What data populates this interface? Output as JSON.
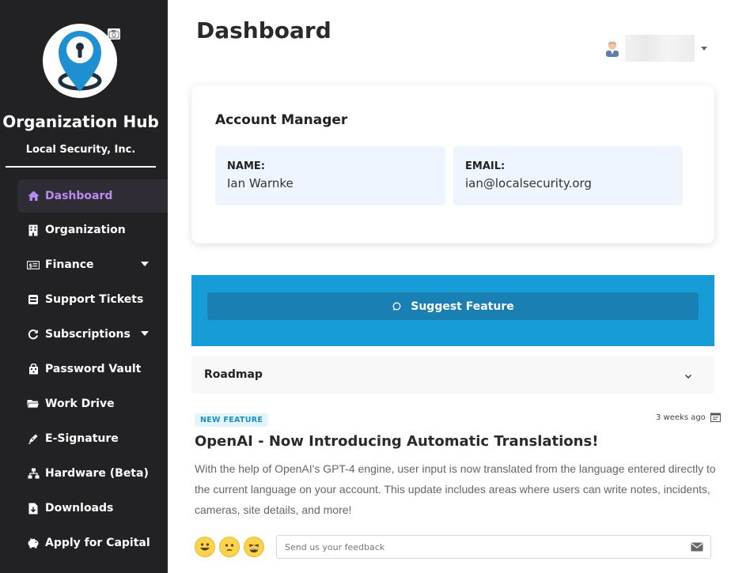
{
  "sidebar": {
    "org_title": "Organization Hub",
    "org_subtitle": "Local Security, Inc.",
    "items": [
      {
        "label": "Dashboard",
        "icon": "home-icon",
        "active": true
      },
      {
        "label": "Organization",
        "icon": "building-icon"
      },
      {
        "label": "Finance",
        "icon": "money-icon",
        "has_submenu": true
      },
      {
        "label": "Support Tickets",
        "icon": "ticket-icon"
      },
      {
        "label": "Subscriptions",
        "icon": "refresh-icon",
        "has_submenu": true
      },
      {
        "label": "Password Vault",
        "icon": "vault-icon"
      },
      {
        "label": "Work Drive",
        "icon": "folder-icon"
      },
      {
        "label": "E-Signature",
        "icon": "pen-icon"
      },
      {
        "label": "Hardware (Beta)",
        "icon": "network-icon"
      },
      {
        "label": "Downloads",
        "icon": "download-file-icon"
      },
      {
        "label": "Apply for Capital",
        "icon": "piggy-bank-icon"
      }
    ]
  },
  "header": {
    "title": "Dashboard"
  },
  "account_manager": {
    "title": "Account Manager",
    "name_label": "NAME:",
    "name_value": "Ian Warnke",
    "email_label": "EMAIL:",
    "email_value": "ian@localsecurity.org"
  },
  "suggest": {
    "button_label": "Suggest Feature"
  },
  "roadmap": {
    "label": "Roadmap"
  },
  "news": {
    "badge": "NEW FEATURE",
    "timestamp": "3 weeks ago",
    "title": "OpenAI - Now Introducing Automatic Translations!",
    "body": "With the help of OpenAI's GPT-4 engine, user input is now translated from the language entered directly to the current language on your account. This update includes areas where users can write notes, incidents, cameras, site details, and more!"
  },
  "feedback": {
    "placeholder": "Send us your feedback",
    "reactions": [
      "happy-face-icon",
      "neutral-face-icon",
      "tired-face-icon"
    ]
  },
  "colors": {
    "sidebar_bg": "#222224",
    "active_nav": "#b58cf0",
    "brand_blue": "#169cd6",
    "button_blue": "#1a7fb2",
    "info_box_bg": "#eef5fe"
  }
}
